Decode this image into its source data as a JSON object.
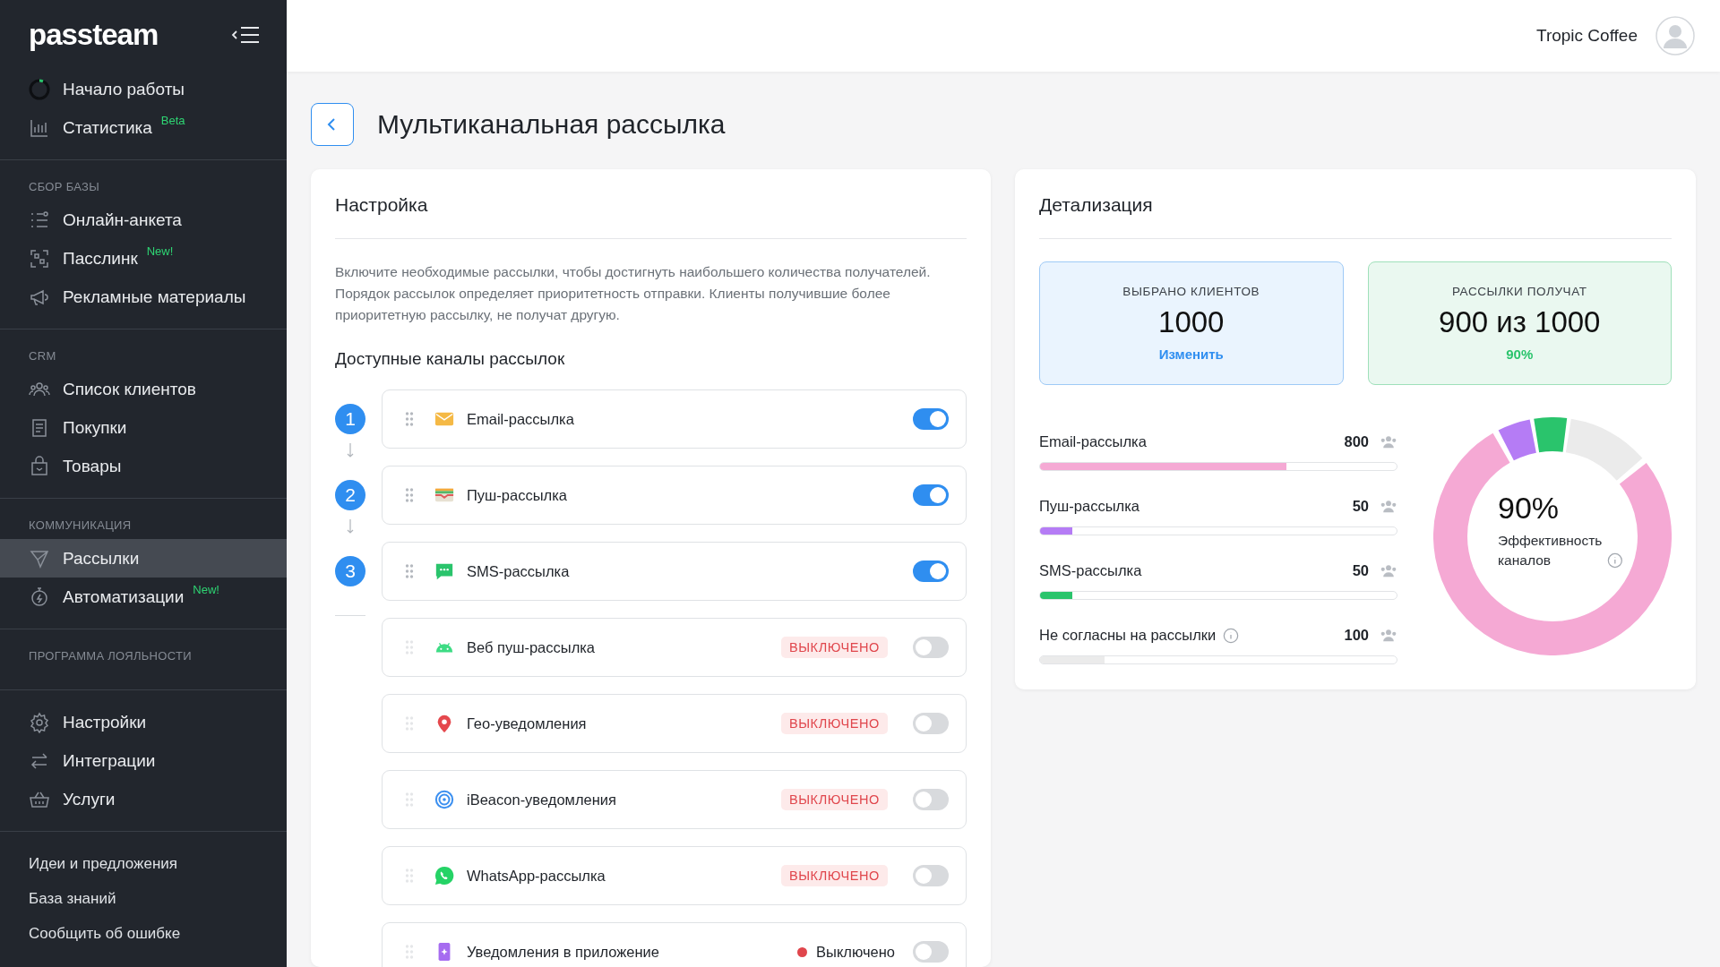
{
  "sidebar": {
    "logo": "passteam",
    "top_items": [
      {
        "label": "Начало работы",
        "selected": false
      },
      {
        "label": "Статистика",
        "badge": "Beta",
        "selected": false
      }
    ],
    "sections": [
      {
        "title": "СБОР БАЗЫ",
        "items": [
          {
            "label": "Онлайн-анкета",
            "selected": false
          },
          {
            "label": "Пасслинк",
            "badge": "New!",
            "selected": false
          },
          {
            "label": "Рекламные материалы",
            "selected": false
          }
        ]
      },
      {
        "title": "CRM",
        "items": [
          {
            "label": "Список клиентов",
            "selected": false
          },
          {
            "label": "Покупки",
            "selected": false
          },
          {
            "label": "Товары",
            "selected": false
          }
        ]
      },
      {
        "title": "КОММУНИКАЦИЯ",
        "items": [
          {
            "label": "Рассылки",
            "selected": true
          },
          {
            "label": "Автоматизации",
            "badge": "New!",
            "selected": false
          }
        ]
      },
      {
        "title": "ПРОГРАММА ЛОЯЛЬНОСТИ"
      }
    ],
    "settings_items": [
      {
        "label": "Настройки",
        "selected": false
      },
      {
        "label": "Интеграции",
        "selected": false
      },
      {
        "label": "Услуги",
        "selected": false
      }
    ],
    "links": [
      "Идеи и предложения",
      "База знаний",
      "Сообщить об ошибке"
    ]
  },
  "header": {
    "company": "Tropic Coffee"
  },
  "page_title": "Мультиканальная рассылка",
  "settings": {
    "title": "Настройка",
    "description": "Включите необходимые рассылки, чтобы достигнуть наибольшего количества получателей. Порядок рассылок определяет приоритетность отправки. Клиенты получившие более приоритетную рассылку, не получат другую.",
    "channels_title": "Доступные каналы рассылок",
    "channels": [
      {
        "number": "1",
        "name": "Email-рассылка",
        "on": true
      },
      {
        "number": "2",
        "name": "Пуш-рассылка",
        "on": true
      },
      {
        "number": "3",
        "name": "SMS-рассылка",
        "on": true
      },
      {
        "name": "Веб пуш-рассылка",
        "on": false,
        "status": "ВЫКЛЮЧЕНО",
        "kind": "badge"
      },
      {
        "name": "Гео-уведомления",
        "on": false,
        "status": "ВЫКЛЮЧЕНО",
        "kind": "badge"
      },
      {
        "name": "iBeacon-уведомления",
        "on": false,
        "status": "ВЫКЛЮЧЕНО",
        "kind": "badge"
      },
      {
        "name": "WhatsApp-рассылка",
        "on": false,
        "status": "ВЫКЛЮЧЕНО",
        "kind": "badge"
      },
      {
        "name": "Уведомления в приложение",
        "on": false,
        "status": "Выключено",
        "kind": "dot"
      }
    ]
  },
  "details": {
    "title": "Детализация",
    "selected": {
      "label": "ВЫБРАНО КЛИЕНТОВ",
      "value": "1000",
      "link": "Изменить"
    },
    "receive": {
      "label": "РАССЫЛКИ ПОЛУЧАТ",
      "value": "900 из 1000",
      "percent": "90%"
    },
    "bars": [
      {
        "name": "Email-рассылка",
        "count": "800",
        "level": 0.69,
        "color": "#f5a9d4"
      },
      {
        "name": "Пуш-рассылка",
        "count": "50",
        "level": 0.09,
        "color": "#b57cf5"
      },
      {
        "name": "SMS-рассылка",
        "count": "50",
        "level": 0.09,
        "color": "#2ac46c"
      },
      {
        "name": "Не согласны на рассылки",
        "count": "100",
        "level": 0.18,
        "color": "#ebebeb",
        "info": true
      }
    ],
    "donut": {
      "value": "90%",
      "label": "Эффективность каналов"
    }
  }
}
